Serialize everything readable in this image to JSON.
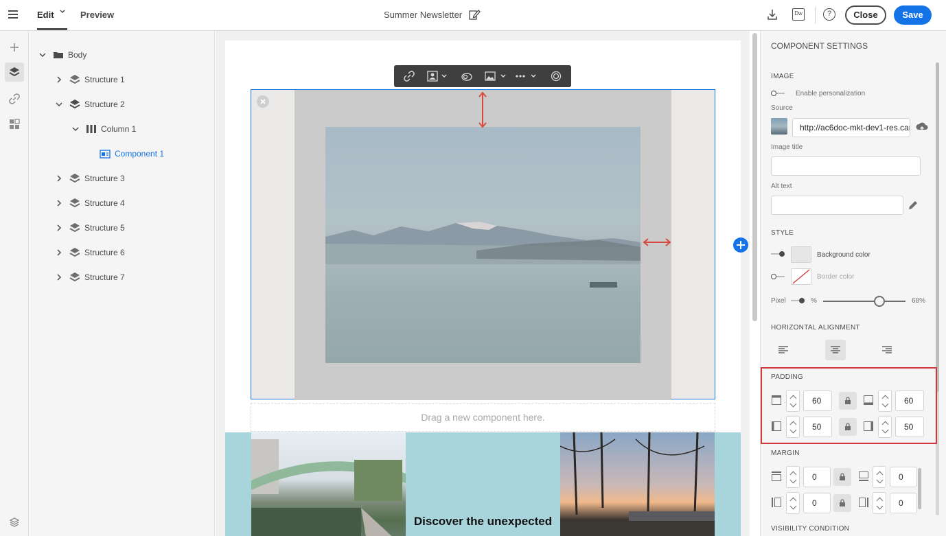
{
  "header": {
    "tabs": {
      "edit": "Edit",
      "preview": "Preview"
    },
    "doc_title": "Summer Newsletter",
    "dw_label": "Dw",
    "help_label": "?",
    "close_label": "Close",
    "save_label": "Save",
    "accent_color": "#1473e6"
  },
  "tree": {
    "root": "Body",
    "items": [
      {
        "label": "Structure 1"
      },
      {
        "label": "Structure 2"
      },
      {
        "label": "Column 1"
      },
      {
        "label": "Component 1"
      },
      {
        "label": "Structure 3"
      },
      {
        "label": "Structure 4"
      },
      {
        "label": "Structure 5"
      },
      {
        "label": "Structure 6"
      },
      {
        "label": "Structure 7"
      }
    ]
  },
  "canvas": {
    "title": "Summer Newsletter",
    "drop_hint": "Drag a new component here.",
    "band_text": "Discover the unexpected"
  },
  "settings": {
    "title": "COMPONENT SETTINGS",
    "image": {
      "section": "IMAGE",
      "enable_personalization": "Enable personalization",
      "source_label": "Source",
      "source_value": "http://ac6doc-mkt-dev1-res.cam",
      "image_title_label": "Image title",
      "image_title_value": "",
      "alt_text_label": "Alt text",
      "alt_text_value": ""
    },
    "style": {
      "section": "STYLE",
      "background_color": "Background color",
      "border_color": "Border color",
      "pixel_label": "Pixel",
      "percent_label": "%",
      "percent_value": "68%",
      "percent_level": 0.68
    },
    "alignment": {
      "section": "HORIZONTAL ALIGNMENT",
      "selected": "center"
    },
    "padding": {
      "section": "PADDING",
      "top": "60",
      "bottom": "60",
      "left": "50",
      "right": "50"
    },
    "margin": {
      "section": "MARGIN",
      "top": "0",
      "bottom": "0",
      "left": "0",
      "right": "0"
    },
    "visibility": {
      "section": "VISIBILITY CONDITION"
    }
  }
}
